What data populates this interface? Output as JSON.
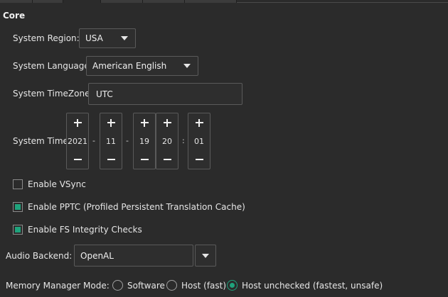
{
  "section": {
    "title": "Core"
  },
  "region": {
    "label": "System Region:",
    "value": "USA"
  },
  "language": {
    "label": "System Language:",
    "value": "American English"
  },
  "timezone": {
    "label": "System TimeZone:",
    "value": "UTC"
  },
  "time": {
    "label": "System Time:",
    "year": "2021",
    "month": "11",
    "day": "19",
    "hour": "20",
    "minute": "01",
    "date_sep": "-",
    "time_sep": ":"
  },
  "checks": {
    "vsync": {
      "label": "Enable VSync",
      "checked": false
    },
    "pptc": {
      "label": "Enable PPTC (Profiled Persistent Translation Cache)",
      "checked": true
    },
    "fs_integrity": {
      "label": "Enable FS Integrity Checks",
      "checked": true
    }
  },
  "audio": {
    "label": "Audio Backend:",
    "value": "OpenAL"
  },
  "memory": {
    "label": "Memory Manager Mode:",
    "options": [
      "Software",
      "Host (fast)",
      "Host unchecked (fastest, unsafe)"
    ],
    "selected": "Host unchecked (fastest, unsafe)"
  },
  "colors": {
    "accent": "#1fa37c",
    "background": "#2b2b2b"
  }
}
